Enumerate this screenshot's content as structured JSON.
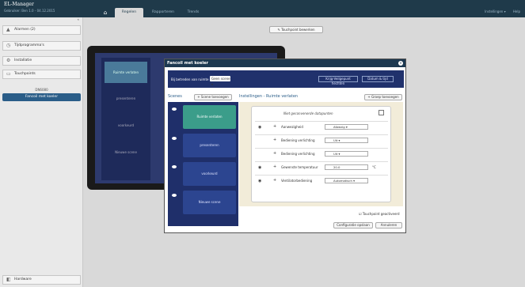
{
  "header": {
    "app_title": "EL-Manager",
    "app_sub": "Gebruiker: Ben 1.0 - 04.12.2015",
    "tabs": [
      {
        "label": "Regelen"
      },
      {
        "label": "Rapporteren"
      },
      {
        "label": "Trends"
      }
    ],
    "right_items": [
      "Instellingen ▾",
      "Help"
    ]
  },
  "sidebar": {
    "items": [
      {
        "label": "Alarmen (2)"
      },
      {
        "label": "Tijdprogramma's"
      },
      {
        "label": "Installatie"
      },
      {
        "label": "Touchpoints"
      }
    ],
    "sub_header": "DN6080",
    "sub_item": "Fancoil met koeler",
    "hardware": "Hardware"
  },
  "touchpoint": {
    "edit_button": "Touchpoint bewerken",
    "tiles": [
      "Ruimte verlaten",
      "presenteren",
      "voorkeurd",
      "Nieuwe scene"
    ]
  },
  "dialog": {
    "title": "Fancoil met koeler",
    "top": {
      "label": "Bij betreden van ruimte",
      "select": "Geen scene",
      "btn_default": "Krijg-Veilgepunt hechten",
      "btn_date": "Datum & tijd"
    },
    "scenes_label": "Scenes",
    "add_scene": "+ Scene toevoegen",
    "settings_label": "Instellingen - Ruimte verlaten",
    "add_group": "+ Groep toevoegen",
    "scenes": [
      "Ruimte verlaten",
      "presenteren",
      "voorkeurd",
      "Nieuwe scene"
    ],
    "mixed_text": "Niet geconvenerde datapunten",
    "rows": [
      {
        "name": "Aanwezigheid",
        "value": "Afwezig",
        "unit": ""
      },
      {
        "name": "Bediening verlichting",
        "value": "Uit",
        "unit": ""
      },
      {
        "name": "Bediening verlichting",
        "value": "Uit",
        "unit": ""
      },
      {
        "name": "Gewenste temperatuur",
        "value": "20.0",
        "unit": "°C"
      },
      {
        "name": "Ventilatorbediening",
        "value": "Automatisch",
        "unit": ""
      }
    ],
    "touchpoint_check": "Touchpoint geactiveerd",
    "save_btn": "Configuratie opslaan",
    "cancel_btn": "Annuleren"
  }
}
